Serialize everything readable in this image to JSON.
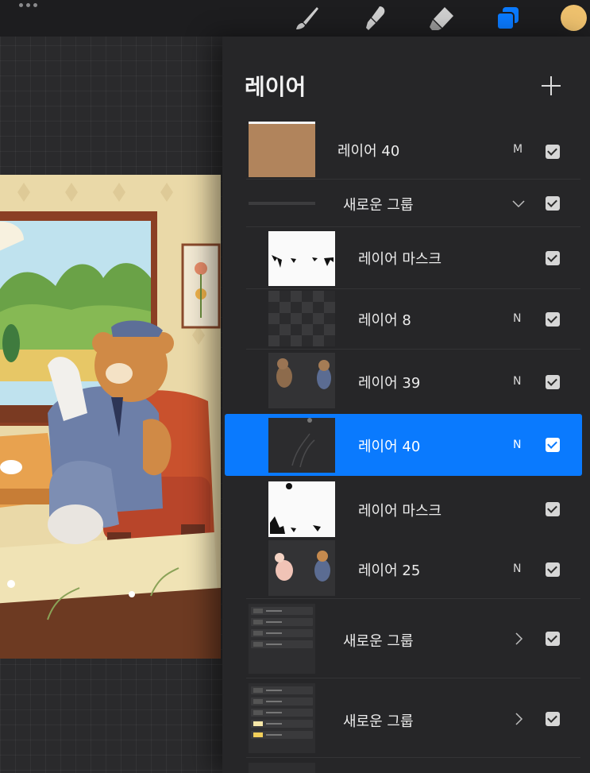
{
  "toolbar": {
    "menu_icon": "ellipsis-icon",
    "tools": [
      {
        "name": "brush-icon",
        "active": false
      },
      {
        "name": "smudge-icon",
        "active": false
      },
      {
        "name": "eraser-icon",
        "active": false
      },
      {
        "name": "layers-icon",
        "active": true
      }
    ],
    "current_color": "#eec16e",
    "accent": "#0a7afe"
  },
  "panel": {
    "title": "레이어",
    "add_icon": "plus-icon",
    "layers": [
      {
        "name": "레이어 40",
        "mode": "M",
        "visible": true
      },
      {
        "name": "새로운 그룹",
        "type": "group",
        "expanded": true,
        "visible": true
      },
      {
        "name": "레이어 마스크",
        "type": "mask",
        "visible": true
      },
      {
        "name": "레이어 8",
        "mode": "N",
        "visible": true
      },
      {
        "name": "레이어 39",
        "mode": "N",
        "visible": true
      },
      {
        "name": "레이어 40",
        "mode": "N",
        "visible": true,
        "selected": true
      },
      {
        "name": "레이어 마스크",
        "type": "mask",
        "visible": true
      },
      {
        "name": "레이어 25",
        "mode": "N",
        "visible": true
      },
      {
        "name": "새로운 그룹",
        "type": "group",
        "expanded": false,
        "visible": true
      },
      {
        "name": "새로운 그룹",
        "type": "group",
        "expanded": false,
        "visible": true
      }
    ]
  }
}
